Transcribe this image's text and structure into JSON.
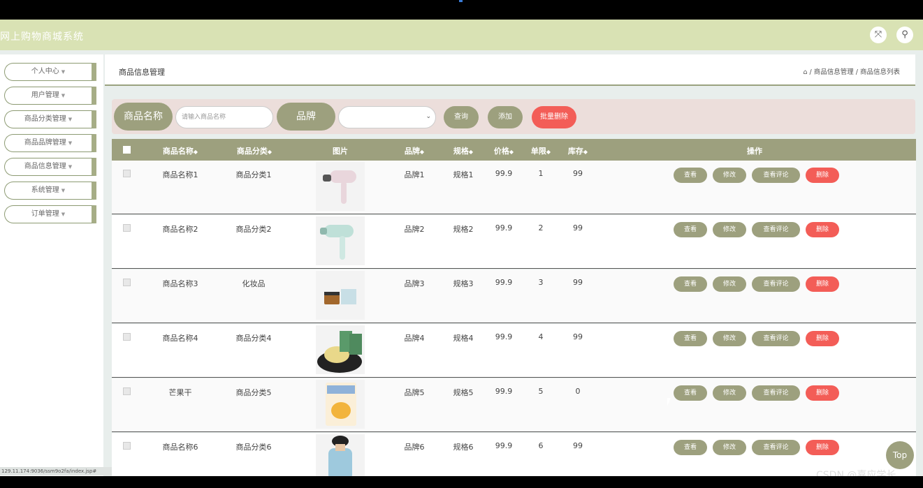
{
  "app": {
    "title": "网上购物商城系统"
  },
  "header": {
    "fullscreen_icon": "expand-icon",
    "user_icon": "user-icon"
  },
  "sidebar": {
    "items": [
      {
        "label": "个人中心"
      },
      {
        "label": "用户管理"
      },
      {
        "label": "商品分类管理"
      },
      {
        "label": "商品品牌管理"
      },
      {
        "label": "商品信息管理"
      },
      {
        "label": "系统管理"
      },
      {
        "label": "订单管理"
      }
    ]
  },
  "page": {
    "title": "商品信息管理",
    "breadcrumb": {
      "home_icon": "home-icon",
      "path": "/ 商品信息管理 / 商品信息列表"
    }
  },
  "search": {
    "name_label": "商品名称",
    "name_placeholder": "请输入商品名称",
    "brand_label": "品牌",
    "brand_value": "",
    "query_button": "查询",
    "add_button": "添加",
    "batch_delete_button": "批量删除"
  },
  "table": {
    "headers": {
      "name": "商品名称",
      "category": "商品分类",
      "image": "图片",
      "brand": "品牌",
      "spec": "规格",
      "price": "价格",
      "limit": "单限",
      "stock": "库存",
      "actions": "操作"
    },
    "sort_glyph": "◆",
    "actions": {
      "view": "查看",
      "edit": "修改",
      "reviews": "查看评论",
      "delete": "删除"
    },
    "rows": [
      {
        "name": "商品名称1",
        "category": "商品分类1",
        "image": "hair-dryer-pink",
        "brand": "品牌1",
        "spec": "规格1",
        "price": "99.9",
        "limit": "1",
        "stock": "99"
      },
      {
        "name": "商品名称2",
        "category": "商品分类2",
        "image": "hair-dryer-mint",
        "brand": "品牌2",
        "spec": "规格2",
        "price": "99.9",
        "limit": "2",
        "stock": "99"
      },
      {
        "name": "商品名称3",
        "category": "化妆品",
        "image": "cosmetics-jar",
        "brand": "品牌3",
        "spec": "规格3",
        "price": "99.9",
        "limit": "3",
        "stock": "99"
      },
      {
        "name": "商品名称4",
        "category": "商品分类4",
        "image": "mooncakes",
        "brand": "品牌4",
        "spec": "规格4",
        "price": "99.9",
        "limit": "4",
        "stock": "99"
      },
      {
        "name": "芒果干",
        "category": "商品分类5",
        "image": "dried-mango-bag",
        "brand": "品牌5",
        "spec": "规格5",
        "price": "99.9",
        "limit": "5",
        "stock": "0"
      },
      {
        "name": "商品名称6",
        "category": "商品分类6",
        "image": "hoodie-model",
        "brand": "品牌6",
        "spec": "规格6",
        "price": "99.9",
        "limit": "6",
        "stock": "99"
      }
    ]
  },
  "back_to_top": "Top",
  "status_url": "129.11.174:9036/ssm9o2fa/index.jsp#",
  "watermark": "CSDN @嘉应学长",
  "colors": {
    "header_bg": "#d9e2b4",
    "accent": "#9da07e",
    "danger": "#f35d57",
    "search_bg": "#ecdedb"
  }
}
